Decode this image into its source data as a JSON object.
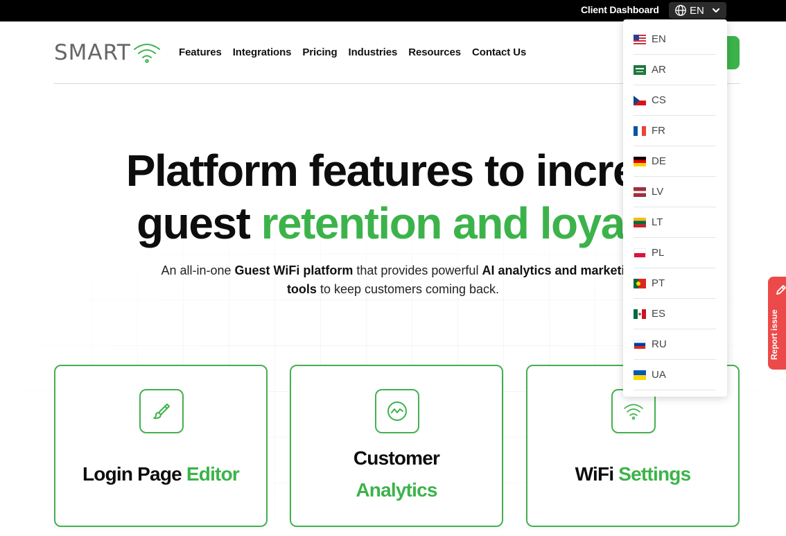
{
  "topbar": {
    "client_dashboard": "Client Dashboard",
    "language_selected": "EN"
  },
  "header": {
    "logo_text": "SMART",
    "nav": [
      "Features",
      "Integrations",
      "Pricing",
      "Industries",
      "Resources",
      "Contact Us"
    ]
  },
  "hero": {
    "title_line1": "Platform features to increa",
    "title_line2_a": "guest ",
    "title_line2_b": "retention and loyalt",
    "sub_1": "An all-in-one ",
    "sub_2": "Guest WiFi platform",
    "sub_3": " that provides powerful ",
    "sub_4": "AI analytics and marketi",
    "sub_5": "tools",
    "sub_6": " to keep customers coming back."
  },
  "cards": [
    {
      "icon": "brush-icon",
      "title_a": "Login Page ",
      "title_b": "Editor"
    },
    {
      "icon": "analytics-icon",
      "title_a": "Customer",
      "title_b": "Analytics"
    },
    {
      "icon": "wifi-icon",
      "title_a": "WiFi ",
      "title_b": "Settings"
    }
  ],
  "languages": [
    "EN",
    "AR",
    "CS",
    "FR",
    "DE",
    "LV",
    "LT",
    "PL",
    "PT",
    "ES",
    "RU",
    "UA"
  ],
  "report_issue": "Report issue",
  "colors": {
    "brand_green": "#3cb34a",
    "topbar": "#000000",
    "report_red": "#ec4a4a"
  }
}
